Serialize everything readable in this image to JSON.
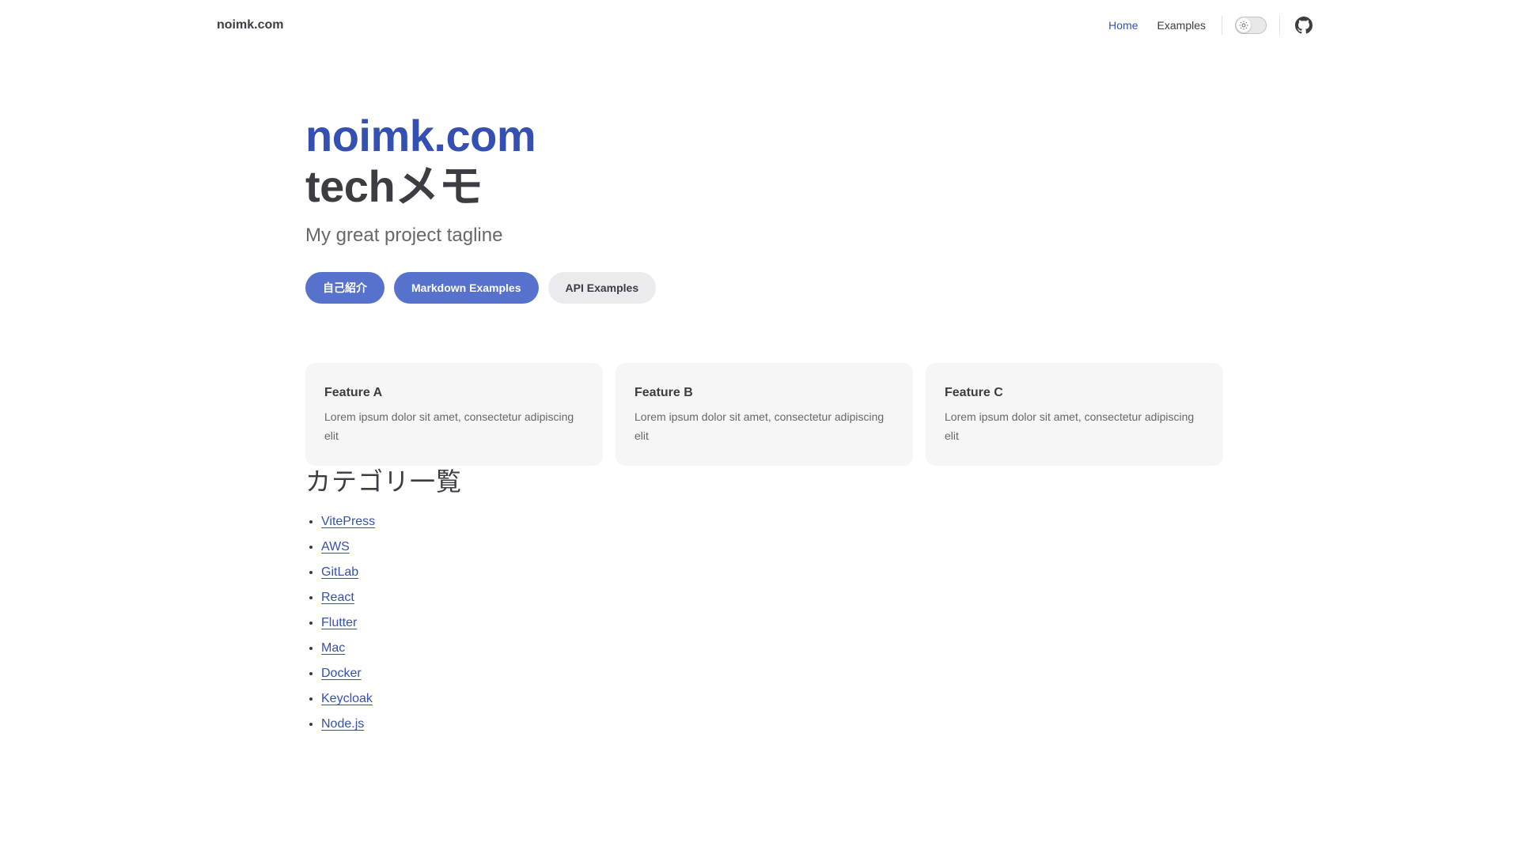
{
  "nav": {
    "site_title": "noimk.com",
    "links": [
      {
        "label": "Home",
        "active": true
      },
      {
        "label": "Examples",
        "active": false
      }
    ],
    "theme_toggle_icon": "sun-icon",
    "social_icon": "github-icon"
  },
  "hero": {
    "name": "noimk.com",
    "text": "techメモ",
    "tagline": "My great project tagline",
    "actions": [
      {
        "label": "自己紹介",
        "theme": "brand"
      },
      {
        "label": "Markdown Examples",
        "theme": "brand"
      },
      {
        "label": "API Examples",
        "theme": "alt"
      }
    ]
  },
  "features": [
    {
      "title": "Feature A",
      "details": "Lorem ipsum dolor sit amet, consectetur adipiscing elit"
    },
    {
      "title": "Feature B",
      "details": "Lorem ipsum dolor sit amet, consectetur adipiscing elit"
    },
    {
      "title": "Feature C",
      "details": "Lorem ipsum dolor sit amet, consectetur adipiscing elit"
    }
  ],
  "categories": {
    "heading": "カテゴリ一覧",
    "items": [
      "VitePress",
      "AWS",
      "GitLab",
      "React",
      "Flutter",
      "Mac",
      "Docker",
      "Keycloak",
      "Node.js"
    ]
  },
  "colors": {
    "brand": "#3451b2",
    "brand_button": "#5672cd",
    "alt_button": "#ebebef",
    "feature_bg": "#f6f6f7",
    "text": "#3c3c43"
  }
}
